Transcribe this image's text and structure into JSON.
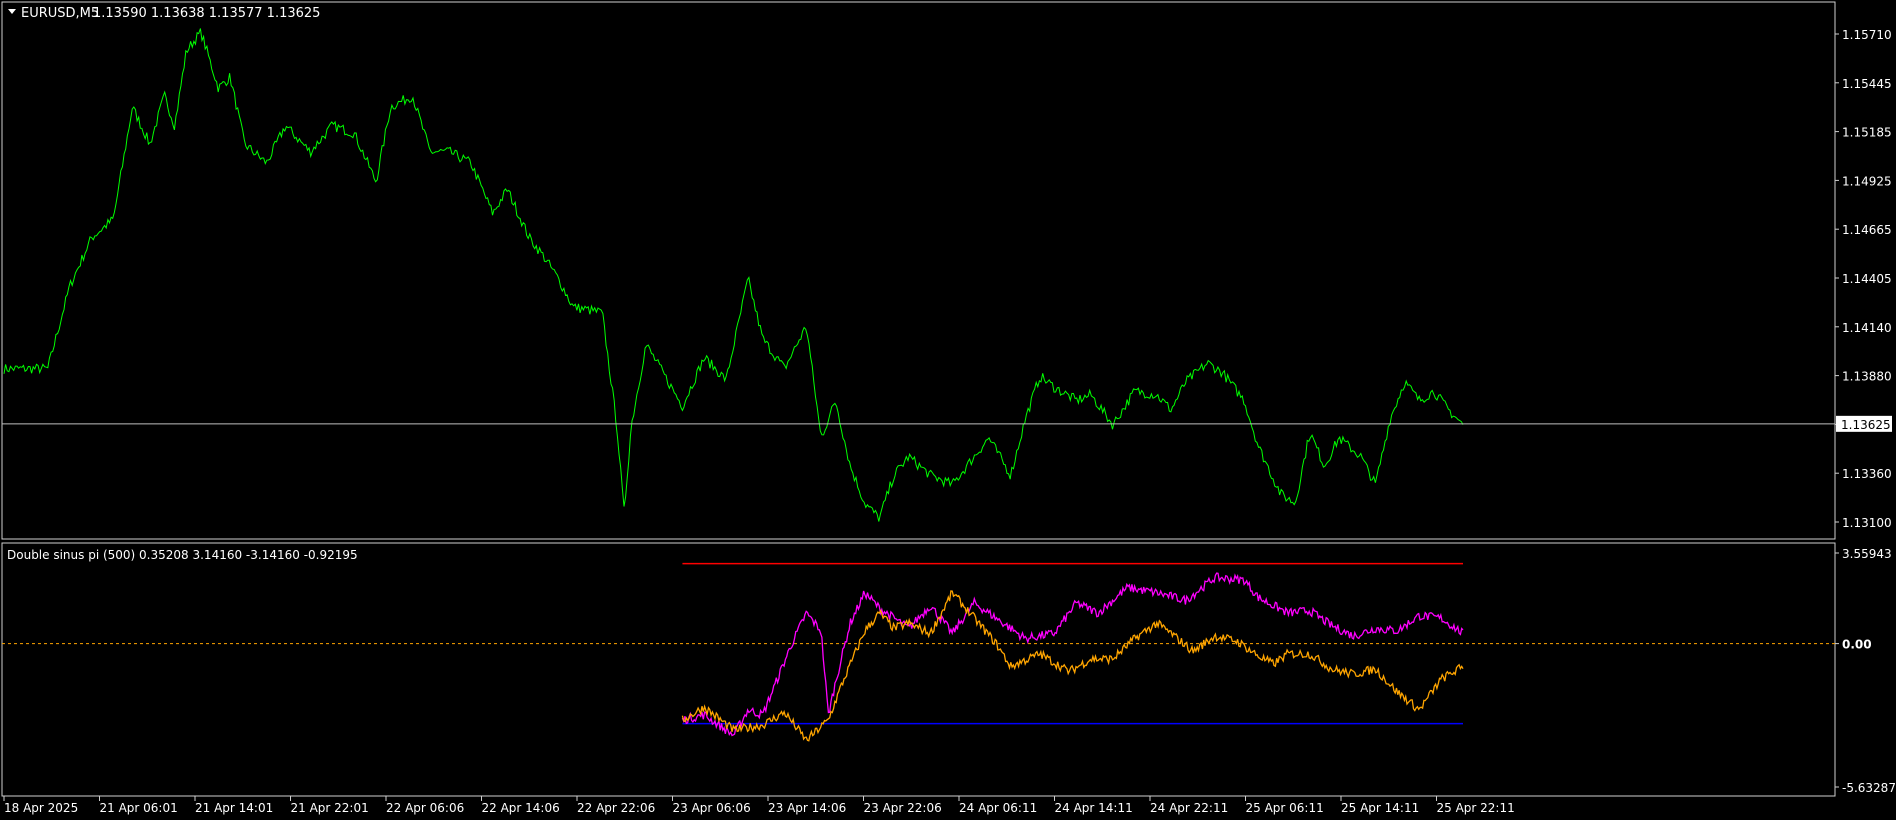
{
  "price_panel": {
    "symbol_label": "EURUSD,M5",
    "ohlc_label": "1.13590 1.13638 1.13577 1.13625",
    "current_price_label": "1.13625"
  },
  "indicator_panel": {
    "title": "Double sinus pi (500) 0.35208 3.14160 -3.14160 -0.92195"
  },
  "colors": {
    "background": "#000000",
    "frame": "#d0d0d0",
    "price_line": "#00ff00",
    "current_price_line": "#c0c0c0",
    "upper_level": "#ff0000",
    "lower_level": "#0000ff",
    "zero_level": "#ffa500",
    "series_magenta": "#ff00ff",
    "series_orange": "#ffa500"
  },
  "chart_data": [
    {
      "type": "line",
      "name": "price",
      "y_tick_labels": [
        "1.15710",
        "1.15445",
        "1.15185",
        "1.14925",
        "1.14665",
        "1.14405",
        "1.14140",
        "1.13880",
        "1.13620",
        "1.13360",
        "1.13100"
      ],
      "ylim": [
        1.131,
        1.1571
      ],
      "current_price": 1.13625,
      "x_tick_labels": [
        "18 Apr 2025",
        "21 Apr 06:01",
        "21 Apr 14:01",
        "21 Apr 22:01",
        "22 Apr 06:06",
        "22 Apr 14:06",
        "22 Apr 22:06",
        "23 Apr 06:06",
        "23 Apr 14:06",
        "23 Apr 22:06",
        "24 Apr 06:11",
        "24 Apr 14:11",
        "24 Apr 22:11",
        "25 Apr 06:11",
        "25 Apr 14:11",
        "25 Apr 22:11"
      ],
      "x": [
        0,
        0.03,
        0.045,
        0.06,
        0.075,
        0.088,
        0.1,
        0.11,
        0.117,
        0.125,
        0.135,
        0.147,
        0.155,
        0.165,
        0.18,
        0.193,
        0.205,
        0.21,
        0.225,
        0.24,
        0.255,
        0.265,
        0.28,
        0.292,
        0.305,
        0.32,
        0.335,
        0.345,
        0.36,
        0.37,
        0.38,
        0.39,
        0.41,
        0.42,
        0.425,
        0.43,
        0.44,
        0.45,
        0.465,
        0.48,
        0.495,
        0.51,
        0.52,
        0.535,
        0.55,
        0.56,
        0.57,
        0.58,
        0.59,
        0.6,
        0.61,
        0.62,
        0.635,
        0.65,
        0.665,
        0.675,
        0.69,
        0.7,
        0.71,
        0.72,
        0.735,
        0.745,
        0.76,
        0.775,
        0.79,
        0.8,
        0.81,
        0.825,
        0.835,
        0.85,
        0.86,
        0.875,
        0.885,
        0.895,
        0.905,
        0.915,
        0.93,
        0.94,
        0.95,
        0.96,
        0.97,
        0.98,
        0.99,
        1.0
      ],
      "y": [
        1.1392,
        1.1392,
        1.1436,
        1.1462,
        1.1472,
        1.1532,
        1.1512,
        1.1538,
        1.1522,
        1.1562,
        1.1572,
        1.1542,
        1.1548,
        1.1512,
        1.1502,
        1.1522,
        1.1512,
        1.1508,
        1.1522,
        1.1518,
        1.1492,
        1.1532,
        1.1538,
        1.1508,
        1.1508,
        1.1502,
        1.1475,
        1.1488,
        1.1462,
        1.1452,
        1.144,
        1.1425,
        1.1422,
        1.1362,
        1.1315,
        1.1362,
        1.1405,
        1.1392,
        1.1372,
        1.1398,
        1.1386,
        1.144,
        1.1408,
        1.1392,
        1.1415,
        1.1355,
        1.1375,
        1.134,
        1.132,
        1.1312,
        1.1335,
        1.1345,
        1.1335,
        1.133,
        1.1345,
        1.1355,
        1.1335,
        1.1365,
        1.1388,
        1.1382,
        1.1375,
        1.1378,
        1.1362,
        1.138,
        1.1378,
        1.137,
        1.1385,
        1.1395,
        1.139,
        1.1375,
        1.135,
        1.1325,
        1.132,
        1.1358,
        1.134,
        1.1355,
        1.1345,
        1.133,
        1.1365,
        1.1385,
        1.1375,
        1.138,
        1.137,
        1.1362
      ]
    },
    {
      "type": "line",
      "name": "indicator",
      "y_tick_labels": [
        "3.55943",
        "0.00",
        "-5.63287"
      ],
      "ylim": [
        -5.63287,
        3.55943
      ],
      "levels": {
        "upper": 3.1416,
        "zero": 0.0,
        "lower": -3.1416
      },
      "x_range": [
        0.465,
        1.0
      ],
      "series": [
        {
          "x": [
            0.465,
            0.48,
            0.5,
            0.51,
            0.52,
            0.53,
            0.54,
            0.55,
            0.56,
            0.565,
            0.57,
            0.58,
            0.59,
            0.6,
            0.62,
            0.635,
            0.65,
            0.665,
            0.68,
            0.7,
            0.72,
            0.735,
            0.75,
            0.77,
            0.79,
            0.81,
            0.83,
            0.85,
            0.86,
            0.87,
            0.88,
            0.895,
            0.91,
            0.925,
            0.94,
            0.955,
            0.97,
            0.985,
            1.0
          ],
          "y": [
            -3.0,
            -2.8,
            -3.6,
            -2.6,
            -2.8,
            -1.4,
            0.0,
            1.2,
            0.5,
            -2.8,
            -1.5,
            0.8,
            2.0,
            1.4,
            0.6,
            1.5,
            0.4,
            1.6,
            1.0,
            0.2,
            0.4,
            1.6,
            1.2,
            2.2,
            2.0,
            1.7,
            2.6,
            2.5,
            1.8,
            1.5,
            1.2,
            1.3,
            0.7,
            0.3,
            0.6,
            0.5,
            1.1,
            1.0,
            0.4
          ]
        },
        {
          "x": [
            0.465,
            0.48,
            0.5,
            0.52,
            0.535,
            0.55,
            0.565,
            0.575,
            0.59,
            0.6,
            0.61,
            0.62,
            0.635,
            0.65,
            0.665,
            0.68,
            0.69,
            0.71,
            0.73,
            0.745,
            0.76,
            0.775,
            0.79,
            0.8,
            0.815,
            0.83,
            0.845,
            0.86,
            0.87,
            0.88,
            0.895,
            0.91,
            0.925,
            0.94,
            0.955,
            0.97,
            0.985,
            1.0
          ],
          "y": [
            -3.0,
            -2.5,
            -3.4,
            -3.2,
            -2.7,
            -3.8,
            -3.0,
            -1.5,
            0.5,
            1.2,
            0.6,
            0.8,
            0.4,
            2.0,
            1.0,
            0.0,
            -0.9,
            -0.4,
            -1.1,
            -0.6,
            -0.6,
            0.2,
            0.8,
            0.4,
            -0.3,
            0.3,
            0.1,
            -0.5,
            -0.8,
            -0.4,
            -0.4,
            -1.0,
            -1.2,
            -1.0,
            -1.9,
            -2.6,
            -1.4,
            -0.9
          ]
        }
      ]
    }
  ]
}
